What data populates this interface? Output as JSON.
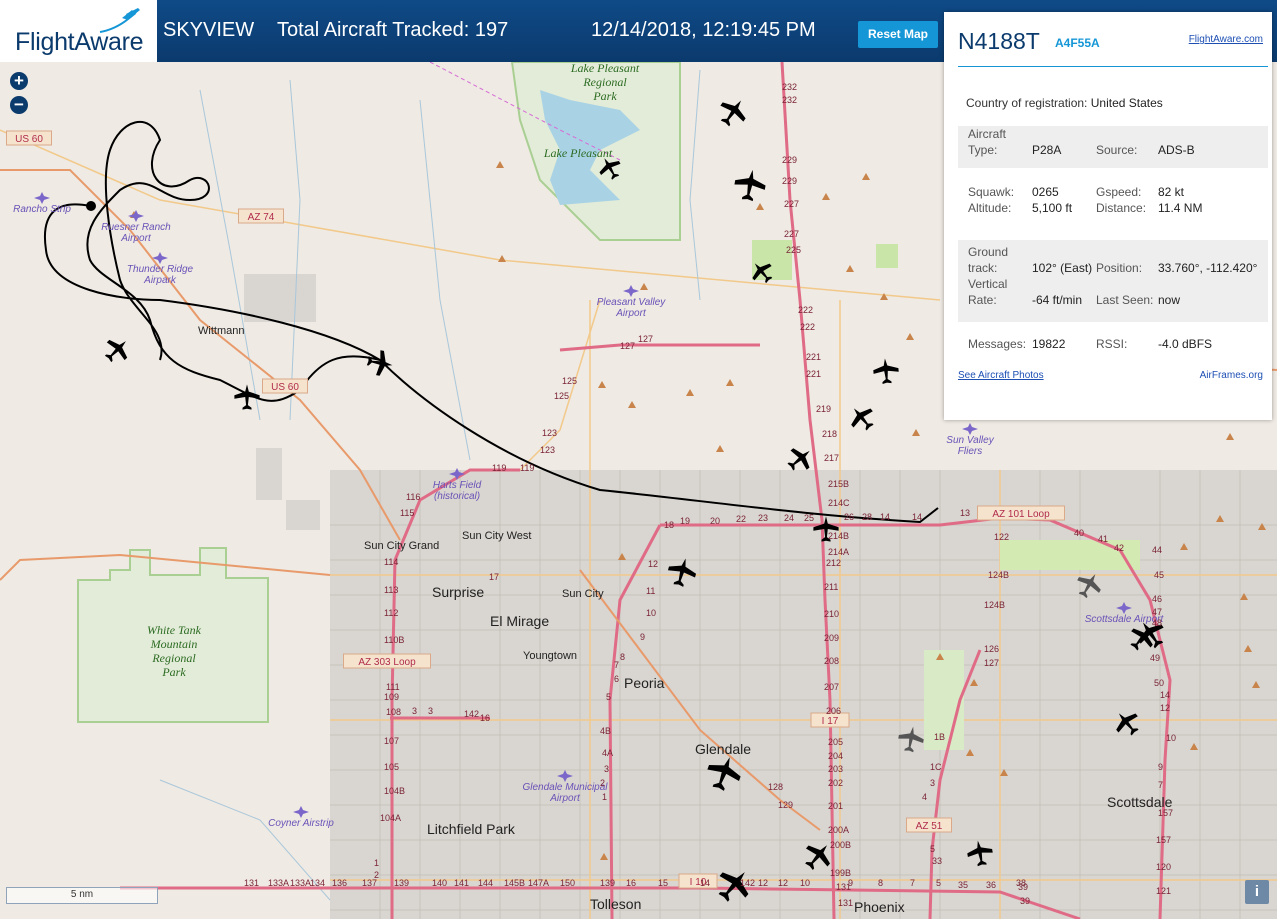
{
  "header": {
    "logo_text": "FlightAware",
    "product": "SKYVIEW",
    "total_tracked_label": "Total Aircraft Tracked: 197",
    "datetime": "12/14/2018, 12:19:45 PM",
    "reset_map": "Reset Map"
  },
  "colors": {
    "header_bg": "#0b3a6d",
    "accent": "#1596d6",
    "track": "#000000"
  },
  "map": {
    "zoom_in": "+",
    "zoom_out": "−",
    "scale_label": "5 nm",
    "info_icon": "i",
    "places": [
      {
        "name": "Wittmann",
        "type": "town"
      },
      {
        "name": "Sun City Grand",
        "type": "town"
      },
      {
        "name": "Sun City West",
        "type": "town"
      },
      {
        "name": "Surprise",
        "type": "city"
      },
      {
        "name": "Sun City",
        "type": "town"
      },
      {
        "name": "El Mirage",
        "type": "city"
      },
      {
        "name": "Youngtown",
        "type": "town"
      },
      {
        "name": "Peoria",
        "type": "city"
      },
      {
        "name": "Glendale",
        "type": "city"
      },
      {
        "name": "Litchfield Park",
        "type": "city"
      },
      {
        "name": "Scottsdale",
        "type": "city"
      },
      {
        "name": "Tolleson",
        "type": "city"
      },
      {
        "name": "Phoenix",
        "type": "city"
      }
    ],
    "parks": [
      {
        "name": "Lake Pleasant Regional Park"
      },
      {
        "name": "Lake Pleasant"
      },
      {
        "name": "White Tank Mountain Regional Park"
      }
    ],
    "airports": [
      {
        "name": "Rancho Strip"
      },
      {
        "name": "Ruesner Ranch Airport"
      },
      {
        "name": "Thunder Ridge Airpark"
      },
      {
        "name": "Pleasant Valley Airport"
      },
      {
        "name": "Harts Field (historical)"
      },
      {
        "name": "Sun Valley Fliers"
      },
      {
        "name": "Scottsdale Airport"
      },
      {
        "name": "Glendale Municipal Airport"
      },
      {
        "name": "Coyner Airstrip"
      }
    ],
    "highways": [
      "US 60",
      "AZ 74",
      "US 60",
      "AZ 303 Loop",
      "AZ 101 Loop",
      "I 17",
      "I 10",
      "AZ 51"
    ],
    "exits": [
      "232",
      "232",
      "229",
      "229",
      "227",
      "227",
      "225",
      "222",
      "222",
      "221",
      "221",
      "219",
      "218",
      "217",
      "215B",
      "214C",
      "214B",
      "214A",
      "212",
      "211",
      "210",
      "209",
      "208",
      "207",
      "206",
      "205",
      "204",
      "203",
      "202",
      "201",
      "200A",
      "200B",
      "199B",
      "131",
      "131",
      "127",
      "127",
      "125",
      "125",
      "123",
      "123",
      "119",
      "119",
      "116",
      "115",
      "114",
      "113",
      "112",
      "110B",
      "111",
      "109",
      "108",
      "107",
      "105",
      "104B",
      "104A",
      "1",
      "2",
      "3",
      "3",
      "142",
      "16",
      "17",
      "18",
      "19",
      "20",
      "22",
      "23",
      "24",
      "25",
      "26",
      "28",
      "14",
      "14",
      "13",
      "12",
      "11",
      "10",
      "9",
      "8",
      "7",
      "6",
      "5",
      "4B",
      "4A",
      "3",
      "2",
      "1",
      "1B",
      "1C",
      "3",
      "4",
      "5",
      "33",
      "35",
      "36",
      "38",
      "39",
      "39",
      "40",
      "41",
      "42",
      "44",
      "45",
      "46",
      "47",
      "48",
      "49",
      "50",
      "14",
      "12",
      "10",
      "9",
      "7",
      "157",
      "157",
      "120",
      "121",
      "122",
      "124B",
      "124B",
      "126",
      "127",
      "128",
      "129",
      "131",
      "133A",
      "133A",
      "134",
      "136",
      "137",
      "139",
      "140",
      "141",
      "144",
      "145B",
      "147A",
      "150",
      "139",
      "16",
      "15",
      "14",
      "12",
      "12",
      "10",
      "9",
      "8",
      "7",
      "5",
      "142"
    ]
  },
  "panel": {
    "tail": "N4188T",
    "hex": "A4F55A",
    "fa_link": "FlightAware.com",
    "country_label": "Country of registration:",
    "country_value": "United States",
    "aircraft_label": "Aircraft",
    "type_label": "Type:",
    "type_value": "P28A",
    "source_label": "Source:",
    "source_value": "ADS-B",
    "squawk_label": "Squawk:",
    "squawk_value": "0265",
    "gspeed_label": "Gspeed:",
    "gspeed_value": "82 kt",
    "altitude_label": "Altitude:",
    "altitude_value": "5,100 ft",
    "distance_label": "Distance:",
    "distance_value": "11.4 NM",
    "ground_label": "Ground",
    "track_label": "track:",
    "track_value": "102° (East)",
    "position_label": "Position:",
    "position_value": "33.760°, -112.420°",
    "vertical_label": "Vertical",
    "rate_label": "Rate:",
    "rate_value": "-64 ft/min",
    "lastseen_label": "Last Seen:",
    "lastseen_value": "now",
    "messages_label": "Messages:",
    "messages_value": "19822",
    "rssi_label": "RSSI:",
    "rssi_value": "-4.0 dBFS",
    "photos_link": "See Aircraft Photos",
    "airframes_link": "AirFrames.org"
  }
}
